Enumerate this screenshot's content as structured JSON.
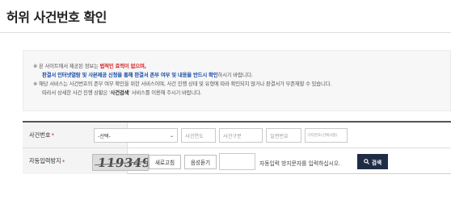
{
  "page": {
    "title": "허위 사건번호 확인"
  },
  "notice": {
    "line1_prefix": "※ 본 사이트에서 제공된 정보는 ",
    "line1_red": "법적인 효력이 없으며,",
    "line2_blue": "판결서 인터넷열람 및 사본제공 신청을 통해 판결서 존부 여부 및 내용을 반드시 확인",
    "line2_suffix": "하시기 바랍니다.",
    "line3": "※ 해당 서비스는 사건번호의 존부 여부 확인을 위한 서비스이며, 사건 진행 상태 및 유형에 따라 확인되지 않거나 판결서가 부존재할 수 있습니다.",
    "line4_prefix": "따라서 상세한 사건 진행 상황은 '",
    "line4_bold": "사건검색",
    "line4_suffix": "' 서비스를 이용해 주시기 바랍니다."
  },
  "form": {
    "case_label": "사건번호",
    "required_mark": "*",
    "court_select_value": "-선택-",
    "year_placeholder": "사건연도",
    "type_placeholder": "사건구분",
    "serial_placeholder": "일련번호",
    "party_placeholder": "가지번호(선택사항)",
    "captcha_label": "자동입력방지",
    "captcha_text": "119349",
    "refresh_label": "새로고침",
    "audio_label": "음성듣기",
    "captcha_hint": "자동입력 방지문자를 입력하십시오.",
    "search_label": "검색"
  }
}
